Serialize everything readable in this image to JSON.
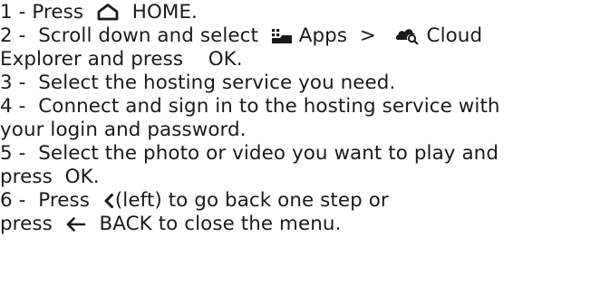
{
  "steps": [
    {
      "num": "1 -",
      "a": "Press",
      "icon": "home-icon",
      "b": "HOME."
    },
    {
      "num": "2 -",
      "a": "Scroll down and select",
      "icon1": "apps-icon",
      "apps": "Apps",
      "sep": ">",
      "icon2": "cloud-explorer-icon",
      "cloud": "Cloud",
      "cloud2": "Explorer",
      "and_press": "and press",
      "ok": "OK",
      "end": "."
    },
    {
      "num": "3 -",
      "text": "Select the hosting service you need."
    },
    {
      "num": "4 -",
      "text": "Connect and sign in to the hosting service with",
      "cont": "your login and password."
    },
    {
      "num": "5 -",
      "text": "Select the photo or video you want to play and",
      "cont_a": "press",
      "ok": "OK",
      "end": "."
    },
    {
      "num": "6 -",
      "a": "Press",
      "icon": "chevron-left-icon",
      "b": "(left) to go back one step or",
      "cont_a": "press",
      "icon2": "back-arrow-icon",
      "back": "BACK",
      "cont_b": "to close the menu."
    }
  ]
}
